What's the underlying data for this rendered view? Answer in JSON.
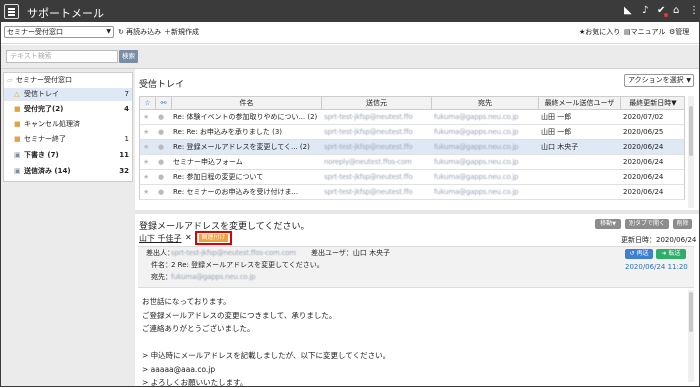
{
  "app": {
    "title": "サポートメール"
  },
  "toolbar": {
    "box_selector": "セミナー受付窓口",
    "reload": "再読み込み",
    "new": "新規作成",
    "favorites": "お気に入り",
    "manual": "マニュアル",
    "admin": "管理"
  },
  "search": {
    "placeholder": "テキスト検索",
    "button": "検索"
  },
  "tree": {
    "root": "セミナー受付窓口",
    "items": [
      {
        "label": "受信トレイ",
        "count": "7"
      },
      {
        "label": "受付完了(2)",
        "count": "4"
      },
      {
        "label": "キャンセル処理済",
        "count": ""
      },
      {
        "label": "セミナー終了",
        "count": "1"
      },
      {
        "label": "下書き (7)",
        "count": "11"
      },
      {
        "label": "送信済み (14)",
        "count": "32"
      }
    ]
  },
  "inbox": {
    "title": "受信トレイ",
    "action_select": "アクションを選択",
    "columns": {
      "subject": "件名",
      "sender": "送信元",
      "recipient": "宛先",
      "last_user": "最終メール送信ユーザ",
      "last_date": "最終更新日時▼"
    },
    "rows": [
      {
        "subject": "Re: 体験イベントの参加取りやめについ... (2)",
        "sender": "sprt-test-jkfsp@neutest.ffo",
        "recipient": "fukuma@gapps.neu.co.jp",
        "last_user": "山田 一郎",
        "date": "2020/07/02"
      },
      {
        "subject": "Re: Re: お申込みを承りました (3)",
        "sender": "sprt-test-jkfsp@neutest.ffo",
        "recipient": "fukuma@gapps.neu.co.jp",
        "last_user": "山田 一郎",
        "date": "2020/06/25"
      },
      {
        "subject": "Re: 登録メールアドレスを変更してく... (2)",
        "sender": "sprt-test-jkfsp@neutest.ffo",
        "recipient": "fukuma@gapps.neu.co.jp",
        "last_user": "山口 木央子",
        "date": "2020/06/24"
      },
      {
        "subject": "セミナー申込フォーム",
        "sender": "noreply@neutest.ffos-com",
        "recipient": "fukuma@gapps.neu.co.jp",
        "last_user": "",
        "date": "2020/06/24"
      },
      {
        "subject": "Re: 参加日程の変更について",
        "sender": "sprt-test-jkfsp@neutest.ffo",
        "recipient": "fukuma@gapps.neu.co.jp",
        "last_user": "",
        "date": "2020/06/24"
      },
      {
        "subject": "Re: セミナーのお申込みを受け付けま...",
        "sender": "sprt-test-jkfsp@neutest.ffo",
        "recipient": "fukuma@gapps.neu.co.jp",
        "last_user": "",
        "date": "2020/06/24"
      }
    ]
  },
  "detail": {
    "subject": "登録メールアドレスを変更してください。",
    "move": "移動",
    "open_tab": "別タブで開く",
    "delete": "削除",
    "sender_name": "山下 千佳子",
    "tag_label": "関連付け",
    "updated_label": "更新日時：2020/06/24 11:20",
    "from_label": "差出人：",
    "from_value": "sprt-test-jkfsp@neutest.ffos-com.com",
    "sender_user_label": "差出ユーザ：山口 木央子",
    "subject_label": "件名：",
    "subject_value": "2 Re: 登録メールアドレスを変更してください。",
    "to_label": "宛先：",
    "to_value": "fukuma@gapps.neu.co.jp",
    "resend": "再送",
    "forward": "転送",
    "date": "2020/06/24 11:20",
    "body": [
      "お世話になっております。",
      "ご登録メールアドレスの変更につきまして、承りました。",
      "ご連絡ありがとうございました。",
      "",
      "> 申込時にメールアドレスを記載しましたが、以下に変更してください。",
      "> aaaaa@aaa.co.jp",
      "> よろしくお願いいたします。"
    ]
  },
  "colors": {
    "topbar": "#3b3b3b",
    "selected": "#dfe9f5",
    "tag": "#f0a23a",
    "highlight_box": "#e00000"
  }
}
